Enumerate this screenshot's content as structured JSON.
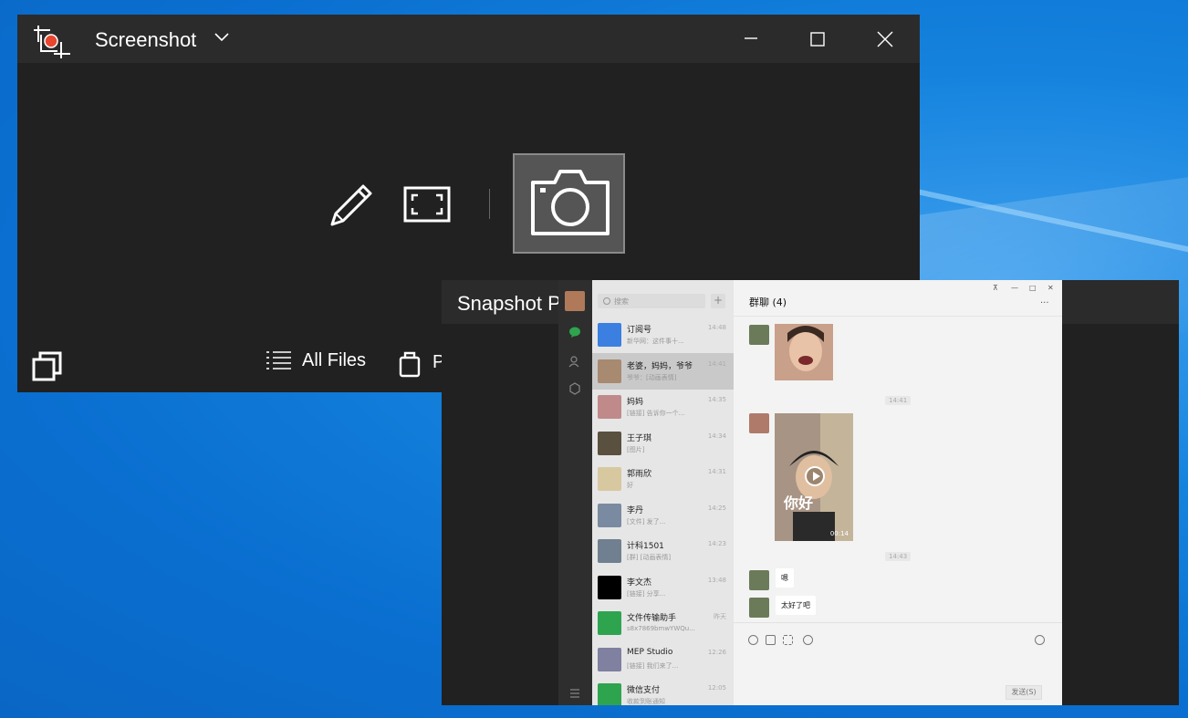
{
  "screenshot_app": {
    "title": "Screenshot",
    "bottom": {
      "all_files_label": "All Files",
      "paste_letter": "P"
    }
  },
  "snapshot_window": {
    "title": "Snapshot P"
  },
  "chat_app": {
    "search_placeholder": "搜索",
    "plus_label": "+",
    "chats": [
      {
        "name": "订阅号",
        "preview": "新华网：这件事十...",
        "time": "14:48",
        "color": "#3b7fe0"
      },
      {
        "name": "老婆，妈妈，爷爷",
        "preview": "爷爷：[动画表情]",
        "time": "14:41",
        "color": "#a88a70"
      },
      {
        "name": "妈妈",
        "preview": "[链接] 告诉你一个...",
        "time": "14:35",
        "color": "#c08a8a"
      },
      {
        "name": "王子琪",
        "preview": "[图片]",
        "time": "14:34",
        "color": "#5a5040"
      },
      {
        "name": "郭雨欣",
        "preview": "好",
        "time": "14:31",
        "color": "#d8c8a0"
      },
      {
        "name": "李丹",
        "preview": "[文件] 发了...",
        "time": "14:25",
        "color": "#7a8aa0"
      },
      {
        "name": "计科1501",
        "preview": "[群] [动画表情]",
        "time": "14:23",
        "color": "#708090"
      },
      {
        "name": "李文杰",
        "preview": "[链接] 分享...",
        "time": "13:48",
        "color": "#000000"
      },
      {
        "name": "文件传输助手",
        "preview": "s8x7869bmwYWQu...",
        "time": "昨天",
        "color": "#2ea44f"
      },
      {
        "name": "MEP Studio",
        "preview": "[链接] 我们来了...",
        "time": "12:26",
        "color": "#8080a0"
      },
      {
        "name": "微信支付",
        "preview": "收款到账通知",
        "time": "12:05",
        "color": "#2ea44f"
      }
    ],
    "conversation": {
      "title": "群聊 (4)",
      "timestamp_1": "14:41",
      "timestamp_2": "14:43",
      "video_caption": "你好",
      "video_duration": "00:14",
      "message_1": "嗯",
      "message_2": "太好了吧",
      "send_label": "发送(S)",
      "window_controls": [
        "⊼",
        "—",
        "□",
        "✕"
      ],
      "more_label": "···"
    }
  }
}
